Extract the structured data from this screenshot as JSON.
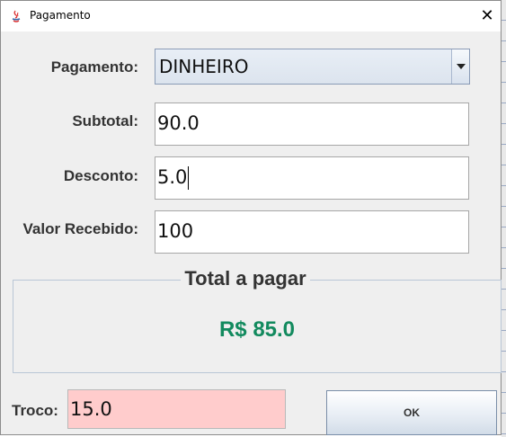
{
  "window": {
    "title": "Pagamento",
    "icon": "java-icon",
    "close_symbol": "✕"
  },
  "form": {
    "pagamento": {
      "label": "Pagamento:",
      "selected": "DINHEIRO"
    },
    "subtotal": {
      "label": "Subtotal:",
      "value": "90.0"
    },
    "desconto": {
      "label": "Desconto:",
      "value": "5.0"
    },
    "valor_recebido": {
      "label": "Valor Recebido:",
      "value": "100"
    }
  },
  "total": {
    "title": "Total a pagar",
    "value": "R$ 85.0",
    "value_color": "#128a5e"
  },
  "troco": {
    "label": "Troco:",
    "value": "15.0",
    "field_color": "#ffcccc"
  },
  "ok_button": {
    "label": "OK"
  }
}
